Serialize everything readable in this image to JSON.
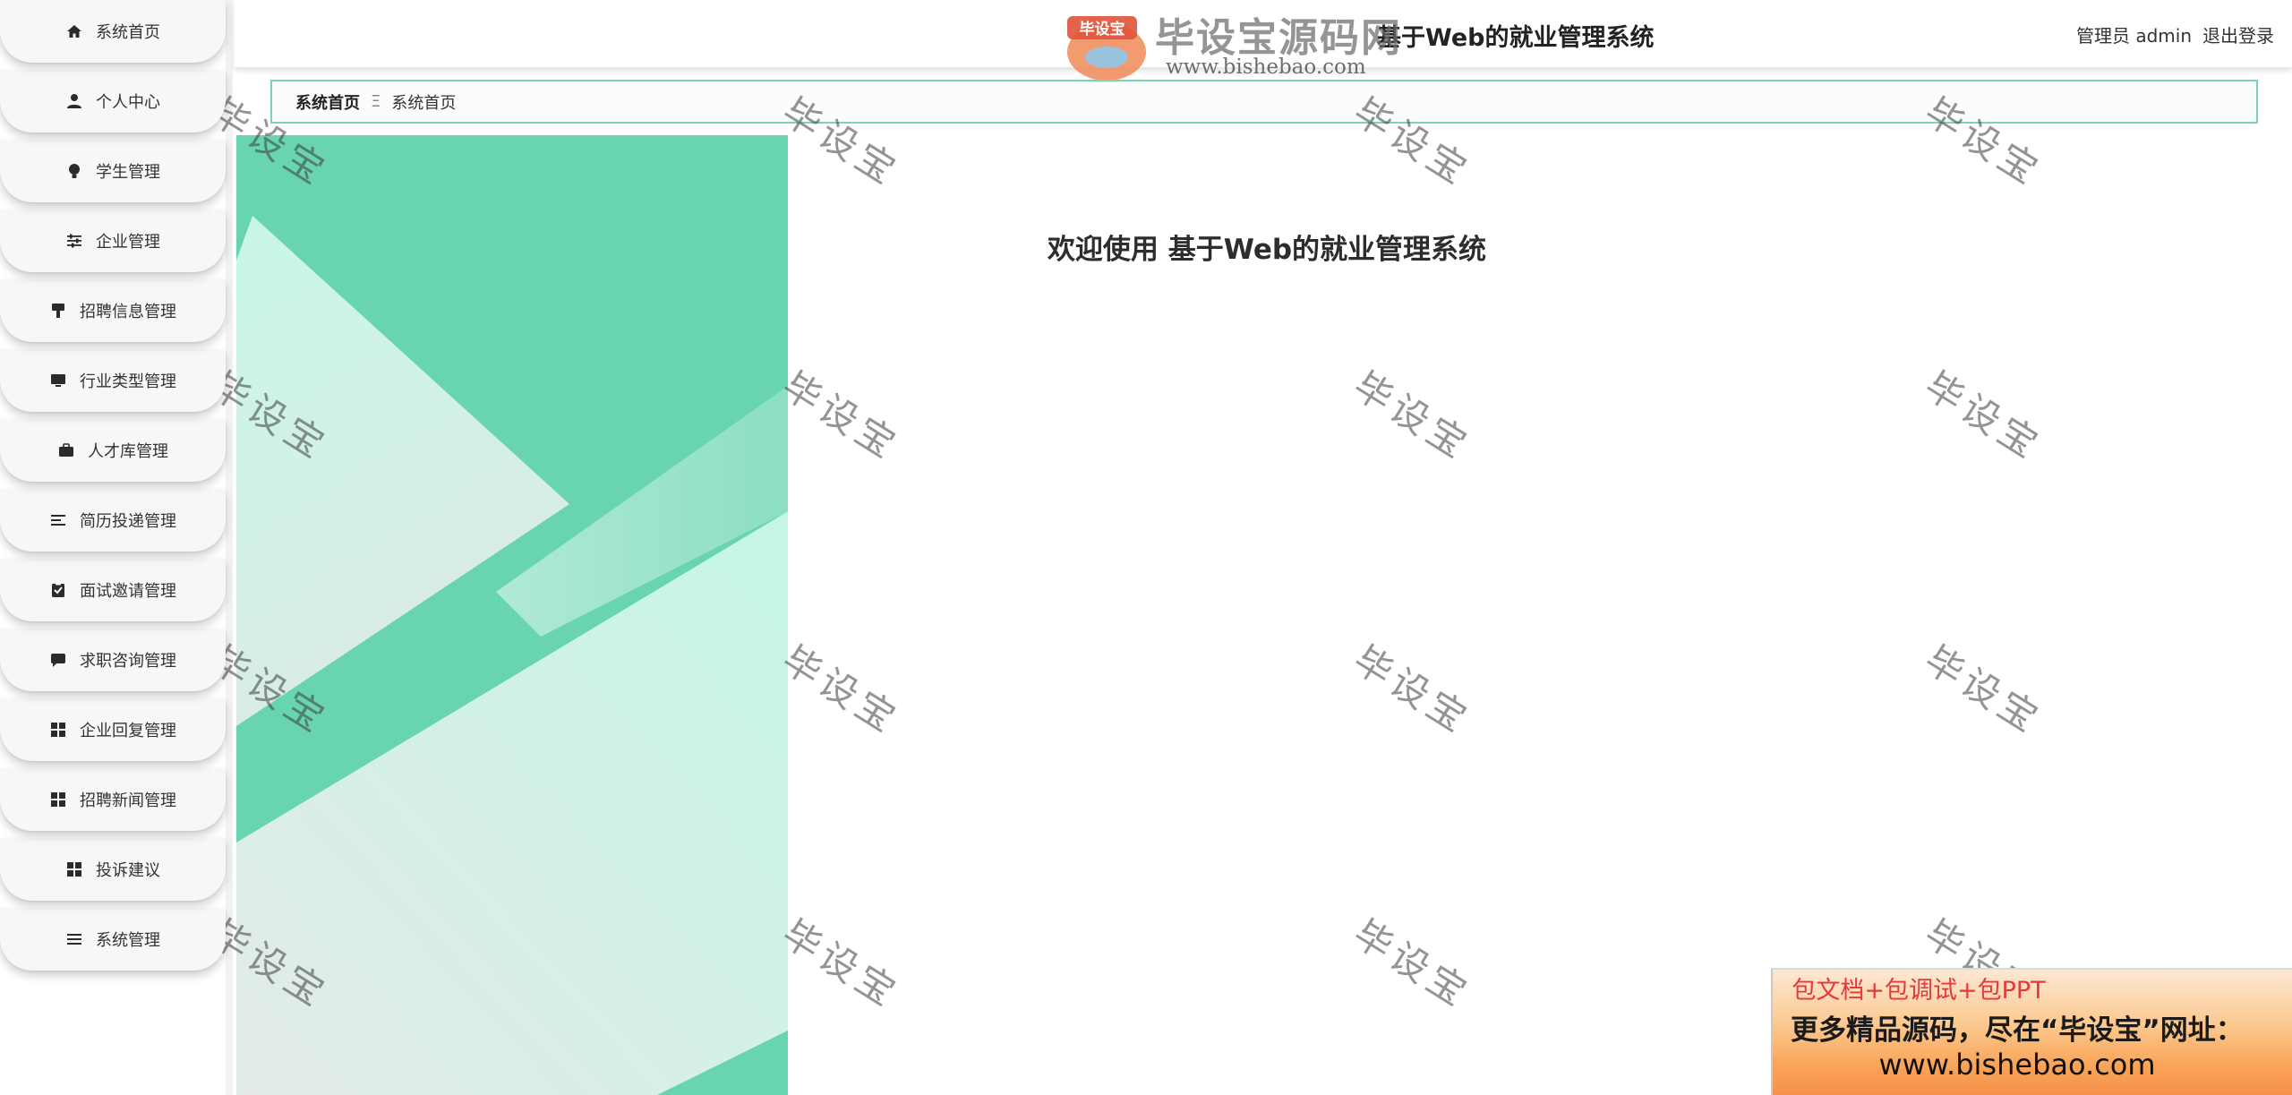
{
  "app": {
    "title": "基于Web的就业管理系统"
  },
  "header": {
    "admin_text": "管理员 admin",
    "logout_label": "退出登录"
  },
  "logo": {
    "brand": "毕设宝源码网",
    "badge": "毕设宝",
    "url": "www.bishebao.com"
  },
  "sidebar": {
    "items": [
      {
        "label": "系统首页",
        "icon": "home-icon"
      },
      {
        "label": "个人中心",
        "icon": "user-icon"
      },
      {
        "label": "学生管理",
        "icon": "bulb-icon"
      },
      {
        "label": "企业管理",
        "icon": "sliders-icon"
      },
      {
        "label": "招聘信息管理",
        "icon": "brush-icon"
      },
      {
        "label": "行业类型管理",
        "icon": "monitor-icon"
      },
      {
        "label": "人才库管理",
        "icon": "briefcase-icon"
      },
      {
        "label": "简历投递管理",
        "icon": "list-icon"
      },
      {
        "label": "面试邀请管理",
        "icon": "clipboard-icon"
      },
      {
        "label": "求职咨询管理",
        "icon": "chat-icon"
      },
      {
        "label": "企业回复管理",
        "icon": "grid-icon"
      },
      {
        "label": "招聘新闻管理",
        "icon": "grid-icon"
      },
      {
        "label": "投诉建议",
        "icon": "grid-icon"
      },
      {
        "label": "系统管理",
        "icon": "menu-icon"
      }
    ]
  },
  "breadcrumb": {
    "home": "系统首页",
    "separator": "Ξ",
    "current": "系统首页"
  },
  "welcome": {
    "text": "欢迎使用 基于Web的就业管理系统"
  },
  "watermark": {
    "text": "毕设宝"
  },
  "ad": {
    "line1": "包文档+包调试+包PPT",
    "line2": "更多精品源码，尽在“毕设宝”网址：",
    "line3": "www.bishebao.com"
  },
  "colors": {
    "accent": "#68d5ae",
    "breadcrumb_border": "#7fd4b0",
    "ad_red": "#e33a3a"
  }
}
